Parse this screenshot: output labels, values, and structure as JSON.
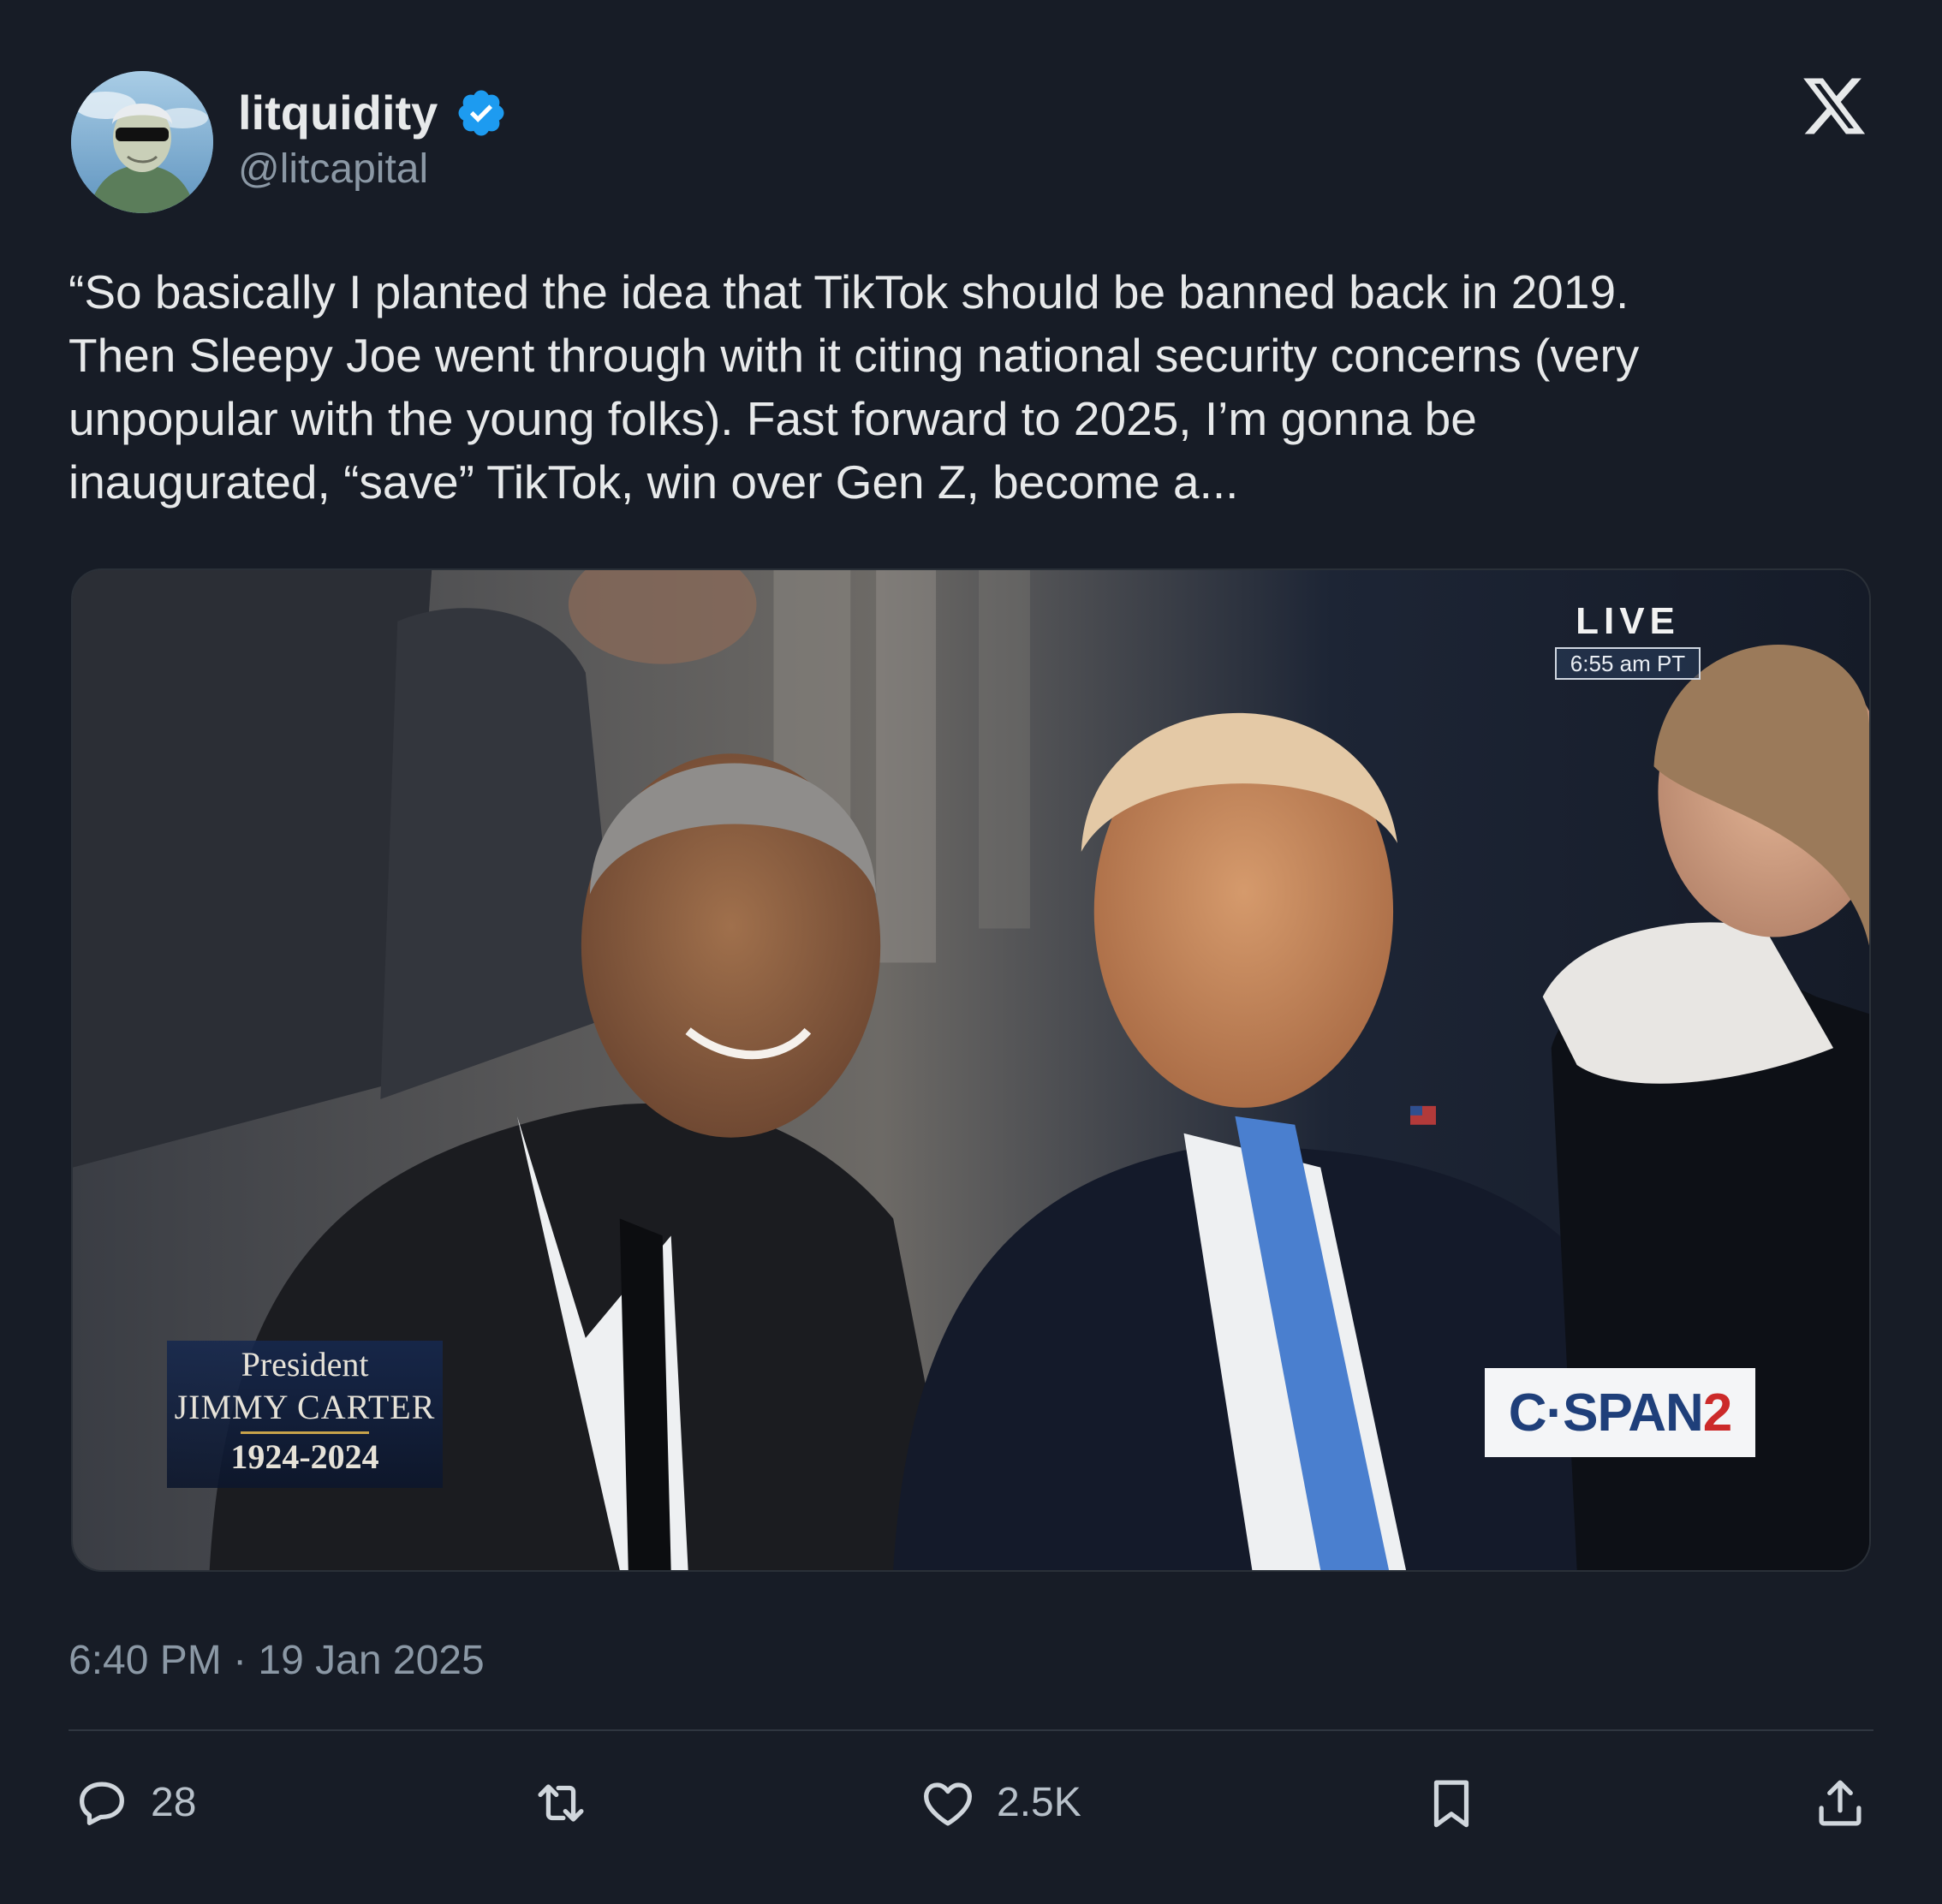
{
  "author": {
    "display_name": "litquidity",
    "handle": "@litcapital",
    "verified": true,
    "avatar_icon": "avatar-sunglasses-portrait"
  },
  "brand_icon": "x-logo-icon",
  "tweet": {
    "text": "“So basically I planted the idea that TikTok should be banned back in 2019.\nThen Sleepy Joe went through with it citing national security concerns (very\nunpopular with the young folks). Fast forward to 2025, I’m gonna be\ninaugurated, “save” TikTok, win over Gen Z, become a..."
  },
  "media": {
    "live_label": "LIVE",
    "live_time": "6:55 am PT",
    "lower_third": {
      "title": "President",
      "name": "JIMMY CARTER",
      "years": "1924-2024"
    },
    "network_logo": {
      "prefix": "C·SPAN",
      "suffix": "2"
    }
  },
  "timestamp": "6:40 PM · 19 Jan 2025",
  "actions": {
    "reply": {
      "icon": "reply-icon",
      "count": "28"
    },
    "repost": {
      "icon": "repost-icon",
      "count": ""
    },
    "like": {
      "icon": "heart-icon",
      "count": "2.5K"
    },
    "bookmark": {
      "icon": "bookmark-icon"
    },
    "share": {
      "icon": "share-icon"
    }
  },
  "colors": {
    "background": "#171c26",
    "text": "#e7e9ea",
    "secondary_text": "#8b98a5",
    "verified_badge": "#1d9bf0"
  }
}
